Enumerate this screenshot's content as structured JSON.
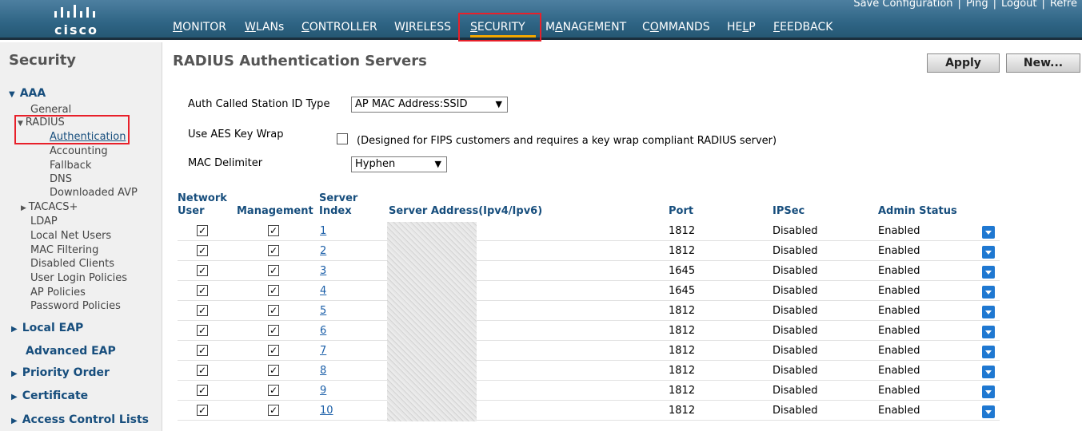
{
  "header": {
    "brand": "cisco",
    "nav": [
      {
        "pre": "",
        "u": "M",
        "post": "ONITOR"
      },
      {
        "pre": "",
        "u": "W",
        "post": "LANs"
      },
      {
        "pre": "",
        "u": "C",
        "post": "ONTROLLER"
      },
      {
        "pre": "W",
        "u": "I",
        "post": "RELESS"
      },
      {
        "pre": "",
        "u": "S",
        "post": "ECURITY"
      },
      {
        "pre": "M",
        "u": "A",
        "post": "NAGEMENT"
      },
      {
        "pre": "C",
        "u": "O",
        "post": "MMANDS"
      },
      {
        "pre": "HE",
        "u": "L",
        "post": "P"
      },
      {
        "pre": "",
        "u": "F",
        "post": "EEDBACK"
      }
    ],
    "utility": {
      "save": "Save Configuration",
      "ping": "Ping",
      "logout": "Logout",
      "refresh": "Refre"
    }
  },
  "sidebar": {
    "title": "Security",
    "aaa": "AAA",
    "general": "General",
    "radius": "RADIUS",
    "radius_items": [
      "Authentication",
      "Accounting",
      "Fallback",
      "DNS",
      "Downloaded AVP"
    ],
    "tacacs": "TACACS+",
    "items": [
      "LDAP",
      "Local Net Users",
      "MAC Filtering",
      "Disabled Clients",
      "User Login Policies",
      "AP Policies",
      "Password Policies"
    ],
    "sections": [
      "Local EAP",
      "Advanced EAP",
      "Priority Order",
      "Certificate",
      "Access Control Lists"
    ]
  },
  "main": {
    "title": "RADIUS Authentication Servers",
    "apply_label": "Apply",
    "new_label": "New...",
    "auth_called_label": "Auth Called Station ID Type",
    "auth_called_value": "AP MAC Address:SSID",
    "aes_label": "Use AES Key Wrap",
    "aes_note": "(Designed for FIPS customers and requires a key wrap compliant RADIUS server)",
    "mac_delim_label": "MAC Delimiter",
    "mac_delim_value": "Hyphen"
  },
  "table": {
    "headers": {
      "network_user_1": "Network",
      "network_user_2": "User",
      "management": "Management",
      "server_index_1": "Server",
      "server_index_2": "Index",
      "server_address": "Server Address(Ipv4/Ipv6)",
      "port": "Port",
      "ipsec": "IPSec",
      "admin_status": "Admin Status"
    },
    "rows": [
      {
        "index": "1",
        "port": "1812",
        "ipsec": "Disabled",
        "status": "Enabled"
      },
      {
        "index": "2",
        "port": "1812",
        "ipsec": "Disabled",
        "status": "Enabled"
      },
      {
        "index": "3",
        "port": "1645",
        "ipsec": "Disabled",
        "status": "Enabled"
      },
      {
        "index": "4",
        "port": "1645",
        "ipsec": "Disabled",
        "status": "Enabled"
      },
      {
        "index": "5",
        "port": "1812",
        "ipsec": "Disabled",
        "status": "Enabled"
      },
      {
        "index": "6",
        "port": "1812",
        "ipsec": "Disabled",
        "status": "Enabled"
      },
      {
        "index": "7",
        "port": "1812",
        "ipsec": "Disabled",
        "status": "Enabled"
      },
      {
        "index": "8",
        "port": "1812",
        "ipsec": "Disabled",
        "status": "Enabled"
      },
      {
        "index": "9",
        "port": "1812",
        "ipsec": "Disabled",
        "status": "Enabled"
      },
      {
        "index": "10",
        "port": "1812",
        "ipsec": "Disabled",
        "status": "Enabled"
      }
    ]
  },
  "colors": {
    "accent": "#174e7d",
    "header": "#2f6585",
    "highlight": "#e8202a",
    "link": "#1a5ea8"
  }
}
